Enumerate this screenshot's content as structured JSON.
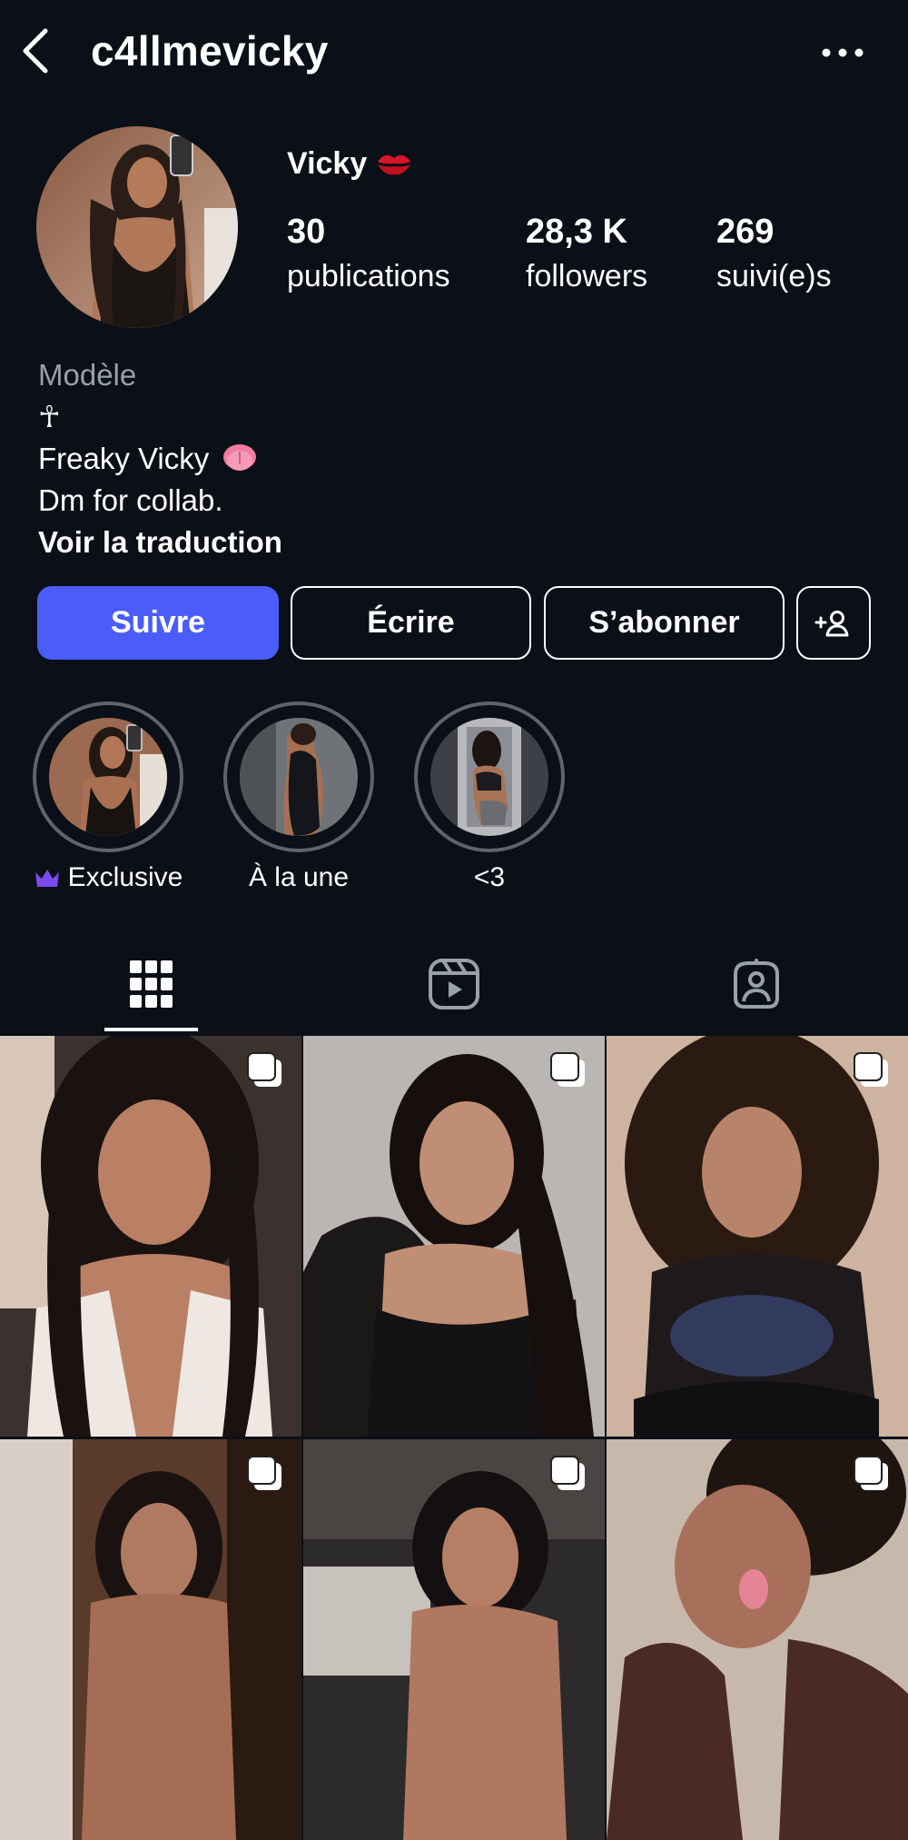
{
  "header": {
    "username": "c4llmevicky"
  },
  "profile": {
    "display_name": "Vicky",
    "name_emoji": "kiss-mark",
    "stats": [
      {
        "value": "30",
        "label": "publications"
      },
      {
        "value": "28,3 K",
        "label": "followers"
      },
      {
        "value": "269",
        "label": "suivi(e)s"
      }
    ],
    "bio": {
      "category": "Modèle",
      "symbol": "☥",
      "line1": "Freaky Vicky",
      "line1_emoji": "tongue",
      "line2": "Dm for collab.",
      "translate": "Voir la traduction"
    }
  },
  "actions": {
    "follow": "Suivre",
    "message": "Écrire",
    "subscribe": "S’abonner"
  },
  "highlights": [
    {
      "label": "Exclusive",
      "icon": "crown-icon"
    },
    {
      "label": "À la une"
    },
    {
      "label": "<3"
    }
  ],
  "tabs": [
    "grid",
    "reels",
    "tagged"
  ],
  "colors": {
    "background": "#0b0f17",
    "primary_button": "#4a5df9",
    "secondary_text": "#9aa0ab",
    "crown": "#7a4cf0"
  }
}
